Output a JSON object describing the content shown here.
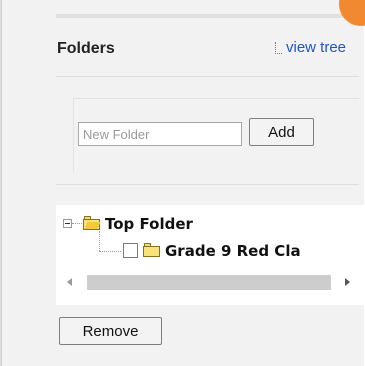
{
  "folders_panel": {
    "title": "Folders",
    "view_tree_link": "view tree",
    "new_folder_placeholder": "New Folder",
    "add_button": "Add",
    "remove_button": "Remove",
    "tree": {
      "root": {
        "label": "Top Folder",
        "expanded": true
      },
      "children": [
        {
          "label": "Grade 9 Red Cla",
          "checked": false
        }
      ]
    }
  },
  "icons": {
    "expander": "collapse-minus-icon",
    "root_folder": "open-folder-icon",
    "child_folder": "folder-icon",
    "view_tree": "tree-icon",
    "scroll_left": "scroll-left-arrow-icon",
    "scroll_right": "scroll-right-arrow-icon"
  },
  "colors": {
    "link": "#1f55c9",
    "folder": "#f8e27a",
    "panel_bg": "#f2f2f2",
    "accent_corner": "#f0892f"
  }
}
